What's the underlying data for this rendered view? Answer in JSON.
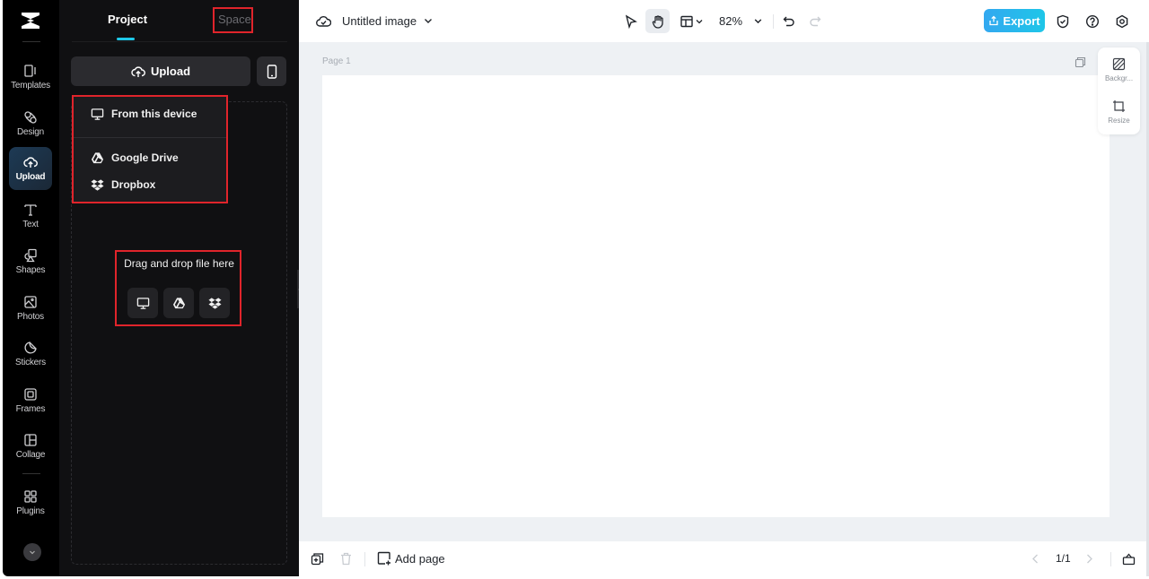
{
  "sidebar": {
    "items": [
      {
        "label": "Templates",
        "icon": "templates-icon",
        "active": false
      },
      {
        "label": "Design",
        "icon": "design-icon",
        "active": false
      },
      {
        "label": "Upload",
        "icon": "upload-cloud-icon",
        "active": true
      },
      {
        "label": "Text",
        "icon": "text-icon",
        "active": false
      },
      {
        "label": "Shapes",
        "icon": "shapes-icon",
        "active": false
      },
      {
        "label": "Photos",
        "icon": "photos-icon",
        "active": false
      },
      {
        "label": "Stickers",
        "icon": "stickers-icon",
        "active": false
      },
      {
        "label": "Frames",
        "icon": "frames-icon",
        "active": false
      },
      {
        "label": "Collage",
        "icon": "collage-icon",
        "active": false
      },
      {
        "label": "Plugins",
        "icon": "plugins-icon",
        "active": false
      }
    ]
  },
  "panel": {
    "tabs": [
      {
        "label": "Project",
        "active": true
      },
      {
        "label": "Space",
        "active": false
      }
    ],
    "upload_label": "Upload",
    "menu": [
      {
        "label": "From this device",
        "icon": "monitor-icon"
      },
      {
        "label": "Google Drive",
        "icon": "google-drive-icon"
      },
      {
        "label": "Dropbox",
        "icon": "dropbox-icon"
      }
    ],
    "drop_text": "Drag and drop file here"
  },
  "topbar": {
    "title": "Untitled image",
    "zoom": "82%",
    "export_label": "Export",
    "accent": "#1ec6e8"
  },
  "canvas": {
    "page_label": "Page 1",
    "side_tools": [
      {
        "label": "Backgr...",
        "icon": "background-icon"
      },
      {
        "label": "Resize",
        "icon": "resize-icon"
      }
    ]
  },
  "bottombar": {
    "add_page_label": "Add page",
    "pager": "1/1"
  }
}
